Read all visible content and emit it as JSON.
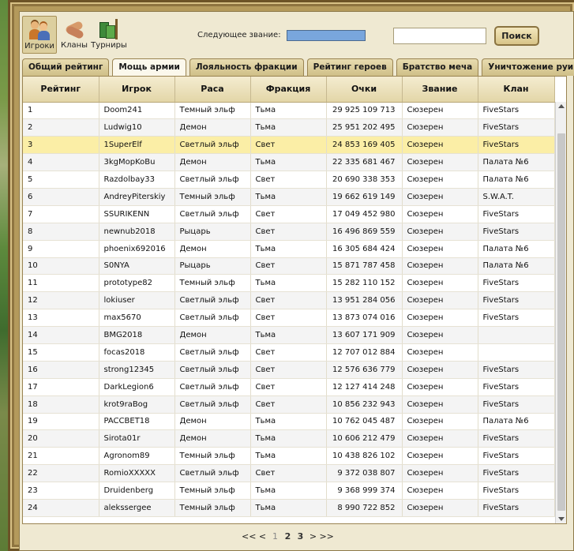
{
  "nav": {
    "players_label": "Игроки",
    "clans_label": "Кланы",
    "tournaments_label": "Турниры"
  },
  "next_rank": {
    "label": "Следующее звание:",
    "progress": 1.0
  },
  "search": {
    "value": "",
    "placeholder": "",
    "button_label": "Поиск"
  },
  "tabs": [
    {
      "label": "Общий рейтинг",
      "active": false
    },
    {
      "label": "Мощь армии",
      "active": true
    },
    {
      "label": "Лояльность фракции",
      "active": false
    },
    {
      "label": "Рейтинг героев",
      "active": false
    },
    {
      "label": "Братство меча",
      "active": false
    },
    {
      "label": "Уничтожение руин",
      "active": false
    }
  ],
  "table": {
    "columns": [
      "Рейтинг",
      "Игрок",
      "Раса",
      "Фракция",
      "Очки",
      "Звание",
      "Клан"
    ],
    "highlight_row": 3,
    "rows": [
      [
        "1",
        "Doom241",
        "Темный эльф",
        "Тьма",
        "29 925 109 713",
        "Сюзерен",
        "FiveStars"
      ],
      [
        "2",
        "Ludwig10",
        "Демон",
        "Тьма",
        "25 951 202 495",
        "Сюзерен",
        "FiveStars"
      ],
      [
        "3",
        "1SuperElf",
        "Светлый эльф",
        "Свет",
        "24 853 169 405",
        "Сюзерен",
        "FiveStars"
      ],
      [
        "4",
        "3kgMopKoBu",
        "Демон",
        "Тьма",
        "22 335 681 467",
        "Сюзерен",
        "Палата №6"
      ],
      [
        "5",
        "Razdolbay33",
        "Светлый эльф",
        "Свет",
        "20 690 338 353",
        "Сюзерен",
        "Палата №6"
      ],
      [
        "6",
        "AndreyPiterskiy",
        "Темный эльф",
        "Тьма",
        "19 662 619 149",
        "Сюзерен",
        "S.W.A.T."
      ],
      [
        "7",
        "SSURIKENN",
        "Светлый эльф",
        "Свет",
        "17 049 452 980",
        "Сюзерен",
        "FiveStars"
      ],
      [
        "8",
        "newnub2018",
        "Рыцарь",
        "Свет",
        "16 496 869 559",
        "Сюзерен",
        "FiveStars"
      ],
      [
        "9",
        "phoenix692016",
        "Демон",
        "Тьма",
        "16 305 684 424",
        "Сюзерен",
        "Палата №6"
      ],
      [
        "10",
        "S0NYA",
        "Рыцарь",
        "Свет",
        "15 871 787 458",
        "Сюзерен",
        "Палата №6"
      ],
      [
        "11",
        "prototype82",
        "Темный эльф",
        "Тьма",
        "15 282 110 152",
        "Сюзерен",
        "FiveStars"
      ],
      [
        "12",
        "lokiuser",
        "Светлый эльф",
        "Свет",
        "13 951 284 056",
        "Сюзерен",
        "FiveStars"
      ],
      [
        "13",
        "max5670",
        "Светлый эльф",
        "Свет",
        "13 873 074 016",
        "Сюзерен",
        "FiveStars"
      ],
      [
        "14",
        "BMG2018",
        "Демон",
        "Тьма",
        "13 607 171 909",
        "Сюзерен",
        ""
      ],
      [
        "15",
        "focas2018",
        "Светлый эльф",
        "Свет",
        "12 707 012 884",
        "Сюзерен",
        ""
      ],
      [
        "16",
        "strong12345",
        "Светлый эльф",
        "Свет",
        "12 576 636 779",
        "Сюзерен",
        "FiveStars"
      ],
      [
        "17",
        "DarkLegion6",
        "Светлый эльф",
        "Свет",
        "12 127 414 248",
        "Сюзерен",
        "FiveStars"
      ],
      [
        "18",
        "krot9raBog",
        "Светлый эльф",
        "Свет",
        "10 856 232 943",
        "Сюзерен",
        "FiveStars"
      ],
      [
        "19",
        "PACCBET18",
        "Демон",
        "Тьма",
        "10 762 045 487",
        "Сюзерен",
        "Палата №6"
      ],
      [
        "20",
        "Sirota01r",
        "Демон",
        "Тьма",
        "10 606 212 479",
        "Сюзерен",
        "FiveStars"
      ],
      [
        "21",
        "Agronom89",
        "Темный эльф",
        "Тьма",
        "10 438 826 102",
        "Сюзерен",
        "FiveStars"
      ],
      [
        "22",
        "RomioXXXXX",
        "Светлый эльф",
        "Свет",
        "9 372 038 807",
        "Сюзерен",
        "FiveStars"
      ],
      [
        "23",
        "Druidenberg",
        "Темный эльф",
        "Тьма",
        "9 368 999 374",
        "Сюзерен",
        "FiveStars"
      ],
      [
        "24",
        "alekssergee",
        "Темный эльф",
        "Тьма",
        "8 990 722 852",
        "Сюзерен",
        "FiveStars"
      ]
    ]
  },
  "pagination": {
    "first": "<<",
    "prev": "<",
    "pages": [
      "1",
      "2",
      "3"
    ],
    "current": "2",
    "next": ">",
    "last": ">>"
  },
  "colors": {
    "highlight": "#fbeea6",
    "rank_bar": "#8fb4e0",
    "panel": "#efe9d2"
  }
}
